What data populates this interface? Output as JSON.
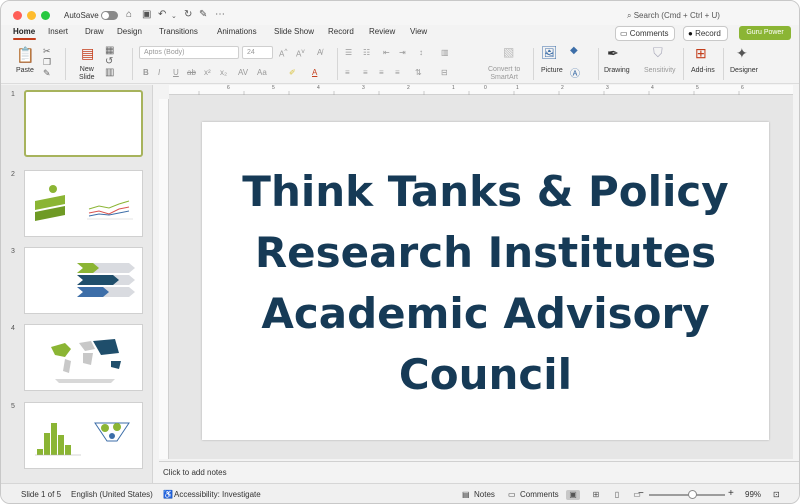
{
  "titlebar": {
    "autosave_label": "AutoSave",
    "search_placeholder": "Search (Cmd + Ctrl + U)"
  },
  "tabs": [
    {
      "label": "Home"
    },
    {
      "label": "Insert"
    },
    {
      "label": "Draw"
    },
    {
      "label": "Design"
    },
    {
      "label": "Transitions"
    },
    {
      "label": "Animations"
    },
    {
      "label": "Slide Show"
    },
    {
      "label": "Record"
    },
    {
      "label": "Review"
    },
    {
      "label": "View"
    }
  ],
  "header_buttons": {
    "comments": "Comments",
    "record": "Record",
    "guru": "Guru Power"
  },
  "ribbon": {
    "paste": "Paste",
    "new_slide": "New\nSlide",
    "font_name": "Aptos (Body)",
    "font_size": "24",
    "convert_smartart": "Convert to\nSmartArt",
    "picture": "Picture",
    "drawing": "Drawing",
    "sensitivity": "Sensitivity",
    "addins": "Add-ins",
    "designer": "Designer"
  },
  "slides": [
    {
      "number": "1"
    },
    {
      "number": "2"
    },
    {
      "number": "3"
    },
    {
      "number": "4"
    },
    {
      "number": "5"
    }
  ],
  "slide_title": "Think Tanks & Policy Research Institutes Academic Advisory Council",
  "notes_placeholder": "Click to add notes",
  "status": {
    "slide_of": "Slide 1 of 5",
    "language": "English (United States)",
    "accessibility": "Accessibility: Investigate",
    "notes": "Notes",
    "comments": "Comments",
    "zoom": "99%"
  },
  "ruler": [
    "6",
    "5",
    "4",
    "3",
    "2",
    "1",
    "0",
    "1",
    "2",
    "3",
    "4",
    "5",
    "6"
  ],
  "colors": {
    "accent": "#c43e1c",
    "slide_title": "#163a56",
    "guru": "#8bb534",
    "thumb_select": "#a7b35c"
  }
}
